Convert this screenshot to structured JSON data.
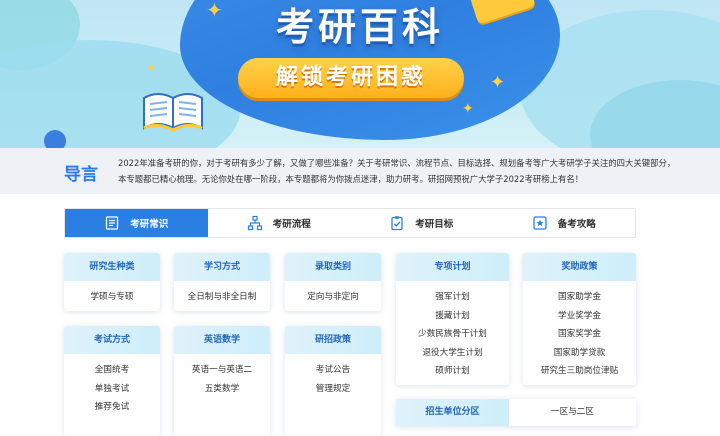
{
  "banner": {
    "title": "考研百科",
    "subtitle": "解锁考研困惑"
  },
  "intro": {
    "heading": "导言",
    "line1": "2022年准备考研的你，对于考研有多少了解，又做了哪些准备？关于考研常识、流程节点、目标选择、规划备考等广大考研学子关注的四大关键部分，",
    "line2": "本专题都已精心梳理。无论你处在哪一阶段，本专题都将为你拨点迷津，助力研考。研招网预祝广大学子2022考研榜上有名！"
  },
  "tabs": [
    {
      "label": "考研常识",
      "icon": "book-icon",
      "active": true
    },
    {
      "label": "考研流程",
      "icon": "flowchart-icon",
      "active": false
    },
    {
      "label": "考研目标",
      "icon": "clipboard-check-icon",
      "active": false
    },
    {
      "label": "备考攻略",
      "icon": "star-badge-icon",
      "active": false
    }
  ],
  "cards": {
    "research_type": {
      "title": "研究生种类",
      "items": [
        "学硕与专硕"
      ]
    },
    "study_mode": {
      "title": "学习方式",
      "items": [
        "全日制与非全日制"
      ]
    },
    "admission_type": {
      "title": "录取类别",
      "items": [
        "定向与非定向"
      ]
    },
    "special_program": {
      "title": "专项计划",
      "items": [
        "强军计划",
        "援藏计划",
        "少数民族骨干计划",
        "退役大学生计划",
        "硕师计划"
      ]
    },
    "reward_policy": {
      "title": "奖助政策",
      "items": [
        "国家助学金",
        "学业奖学金",
        "国家奖学金",
        "国家助学贷款",
        "研究生三助岗位津贴"
      ]
    },
    "exam_method": {
      "title": "考试方式",
      "items": [
        "全国统考",
        "单独考试",
        "推荐免试"
      ]
    },
    "english_math": {
      "title": "英语数学",
      "items": [
        "英语一与英语二",
        "五类数学"
      ]
    },
    "admission_policy": {
      "title": "研招政策",
      "items": [
        "考试公告",
        "管理规定"
      ]
    }
  },
  "district": {
    "label": "招生单位分区",
    "value": "一区与二区"
  },
  "colors": {
    "accent": "#2b7fe2",
    "card_header_text": "#2467b8",
    "pill": "#ffb01c"
  }
}
